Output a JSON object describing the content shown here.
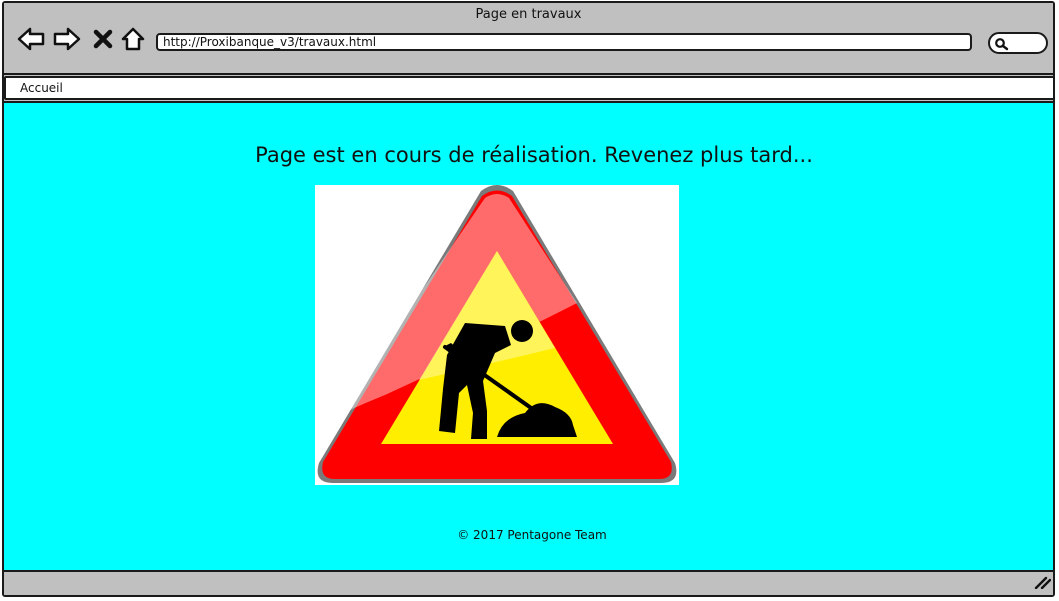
{
  "window": {
    "title": "Page en travaux"
  },
  "toolbar": {
    "back_icon": "back-arrow-icon",
    "forward_icon": "forward-arrow-icon",
    "stop_icon": "close-icon",
    "home_icon": "home-icon",
    "url": "http://Proxibanque_v3/travaux.html",
    "search_icon": "search-icon"
  },
  "menu": {
    "items": [
      {
        "label": "Accueil"
      }
    ]
  },
  "main": {
    "message": "Page est en cours de réalisation. Revenez plus tard...",
    "image_icon": "roadwork-warning-sign-icon",
    "footer": "© 2017 Pentagone Team"
  },
  "colors": {
    "content_background": "#00ffff",
    "chrome": "#c0c0c0",
    "sign_red": "#ff0000",
    "sign_yellow": "#ffee00"
  }
}
